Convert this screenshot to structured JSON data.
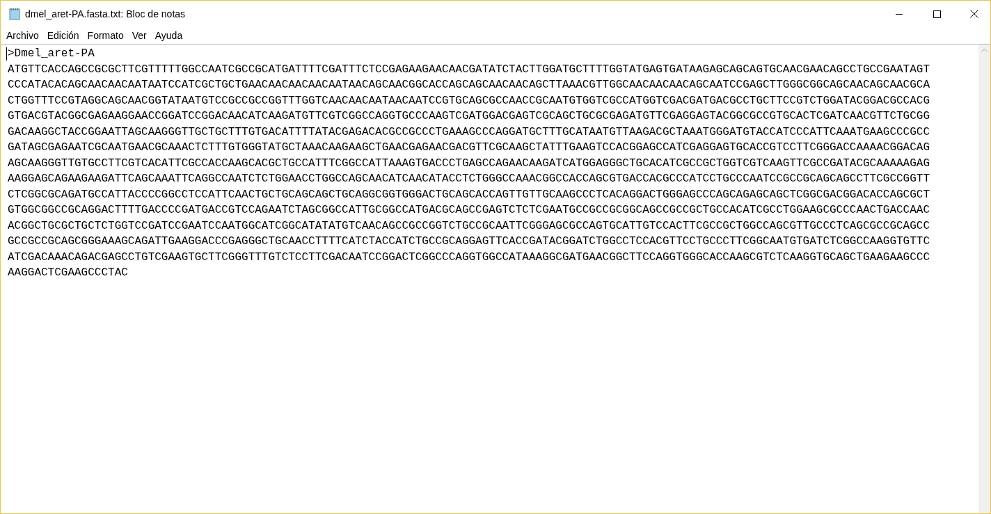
{
  "window": {
    "title": "dmel_aret-PA.fasta.txt: Bloc de notas"
  },
  "menu": [
    "Archivo",
    "Edición",
    "Formato",
    "Ver",
    "Ayuda"
  ],
  "document": {
    "lines": [
      ">Dmel_aret-PA",
      "ATGTTCACCAGCCGCGCTTCGTTTTTGGCCAATCGCCGCATGATTTTCGATTTCTCCGAGAAGAACAACGATATCTACTTGGATGCTTTTGGTATGAGTGATAAGAGCAGCAGTGCAACGAACAGCCTGCCGAATAGT",
      "CCCATACACAGCAACAACAATAATCCATCGCTGCTGAACAACAACAACAATAACAGCAACGGCACCAGCAGCAACAACAGCTTAAACGTTGGCAACAACAACAGCAATCCGAGCTTGGGCGGCAGCAACAGCAACGCA",
      "CTGGTTTCCGTAGGCAGCAACGGTATAATGTCCGCCGCCGGTTTGGTCAACAACAATAACAATCCGTGCAGCGCCAACCGCAATGTGGTCGCCATGGTCGACGATGACGCCTGCTTCCGTCTGGATACGGACGCCACG",
      "GTGACGTACGGCGAGAAGGAACCGGATCCGGACAACATCAAGATGTTCGTCGGCCAGGTGCCCAAGTCGATGGACGAGTCGCAGCTGCGCGAGATGTTCGAGGAGTACGGCGCCGTGCACTCGATCAACGTTCTGCGG",
      "GACAAGGCTACCGGAATTAGCAAGGGTTGCTGCTTTGTGACATTTTATACGAGACACGCCGCCCTGAAAGCCCAGGATGCTTTGCATAATGTTAAGACGCTAAATGGGATGTACCATCCCATTCAAATGAAGCCCGCC",
      "GATAGCGAGAATCGCAATGAACGCAAACTCTTTGTGGGTATGCTAAACAAGAAGCTGAACGAGAACGACGTTCGCAAGCTATTTGAAGTCCACGGAGCCATCGAGGAGTGCACCGTCCTTCGGGACCAAAACGGACAG",
      "AGCAAGGGTTGTGCCTTCGTCACATTCGCCACCAAGCACGCTGCCATTTCGGCCATTAAAGTGACCCTGAGCCAGAACAAGATCATGGAGGGCTGCACATCGCCGCTGGTCGTCAAGTTCGCCGATACGCAAAAAGAG",
      "AAGGAGCAGAAGAAGATTCAGCAAATTCAGGCCAATCTCTGGAACCTGGCCAGCAACATCAACATACCTCTGGGCCAAACGGCCACCAGCGTGACCACGCCCATCCTGCCCAATCCGCCGCAGCAGCCTTCGCCGGTT",
      "CTCGGCGCAGATGCCATTACCCCGGCCTCCATTCAACTGCTGCAGCAGCTGCAGGCGGTGGGACTGCAGCACCAGTTGTTGCAAGCCCTCACAGGACTGGGAGCCCAGCAGAGCAGCTCGGCGACGGACACCAGCGCT",
      "GTGGCGGCCGCAGGACTTTTGACCCCGATGACCGTCCAGAATCTAGCGGCCATTGCGGCCATGACGCAGCCGAGTCTCTCGAATGCCGCCGCGGCAGCCGCCGCTGCCACATCGCCTGGAAGCGCCCAACTGACCAAC",
      "ACGGCTGCGCTGCTCTGGTCCGATCCGAATCCAATGGCATCGGCATATATGTCAACAGCCGCCGGTCTGCCGCAATTCGGGAGCGCCAGTGCATTGTCCACTTCGCCGCTGGCCAGCGTTGCCCTCAGCGCCGCAGCC",
      "GCCGCCGCAGCGGGAAAGCAGATTGAAGGACCCGAGGGCTGCAACCTTTTCATCTACCATCTGCCGCAGGAGTTCACCGATACGGATCTGGCCTCCACGTTCCTGCCCTTCGGCAATGTGATCTCGGCCAAGGTGTTC",
      "ATCGACAAACAGACGAGCCTGTCGAAGTGCTTCGGGTTTGTCTCCTTCGACAATCCGGACTCGGCCCAGGTGGCCATAAAGGCGATGAACGGCTTCCAGGTGGGCACCAAGCGTCTCAAGGTGCAGCTGAAGAAGCCC",
      "AAGGACTCGAAGCCCTAC"
    ]
  }
}
